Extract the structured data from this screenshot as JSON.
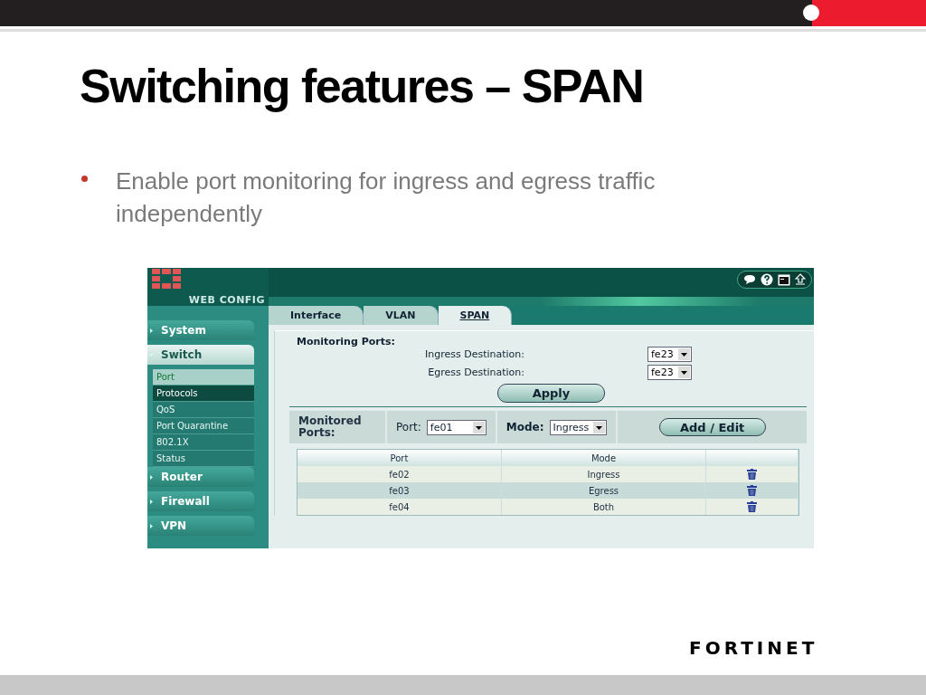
{
  "title": "Switching features – SPAN",
  "bullets": [
    "Enable port monitoring for ingress and egress traffic independently"
  ],
  "app": {
    "brand": "WEB CONFIG",
    "sidebar": [
      {
        "label": "System",
        "expanded": false
      },
      {
        "label": "Switch",
        "expanded": true,
        "children": [
          {
            "label": "Port",
            "selected": true,
            "hover": false
          },
          {
            "label": "Protocols",
            "selected": false,
            "hover": true
          },
          {
            "label": "QoS",
            "selected": false,
            "hover": false
          },
          {
            "label": "Port Quarantine",
            "selected": false,
            "hover": false
          },
          {
            "label": "802.1X",
            "selected": false,
            "hover": false
          },
          {
            "label": "Status",
            "selected": false,
            "hover": false
          }
        ]
      },
      {
        "label": "Router",
        "expanded": false
      },
      {
        "label": "Firewall",
        "expanded": false
      },
      {
        "label": "VPN",
        "expanded": false
      }
    ],
    "tabs": [
      {
        "label": "Interface",
        "selected": false
      },
      {
        "label": "VLAN",
        "selected": false
      },
      {
        "label": "SPAN",
        "selected": true
      }
    ],
    "monitoring": {
      "heading": "Monitoring Ports:",
      "fields": [
        {
          "label": "Ingress Destination:",
          "value": "fe23"
        },
        {
          "label": "Egress Destination:",
          "value": "fe23"
        }
      ],
      "button": "Apply"
    },
    "monitored": {
      "heading": "Monitored Ports:",
      "port_label": "Port:",
      "port_value": "fe01",
      "mode_label": "Mode:",
      "mode_value": "Ingress",
      "button": "Add / Edit"
    },
    "table": {
      "columns": [
        "Port",
        "Mode"
      ],
      "rows": [
        {
          "port": "fe02",
          "mode": "Ingress"
        },
        {
          "port": "fe03",
          "mode": "Egress"
        },
        {
          "port": "fe04",
          "mode": "Both"
        }
      ]
    }
  },
  "logo": "FORTINET"
}
